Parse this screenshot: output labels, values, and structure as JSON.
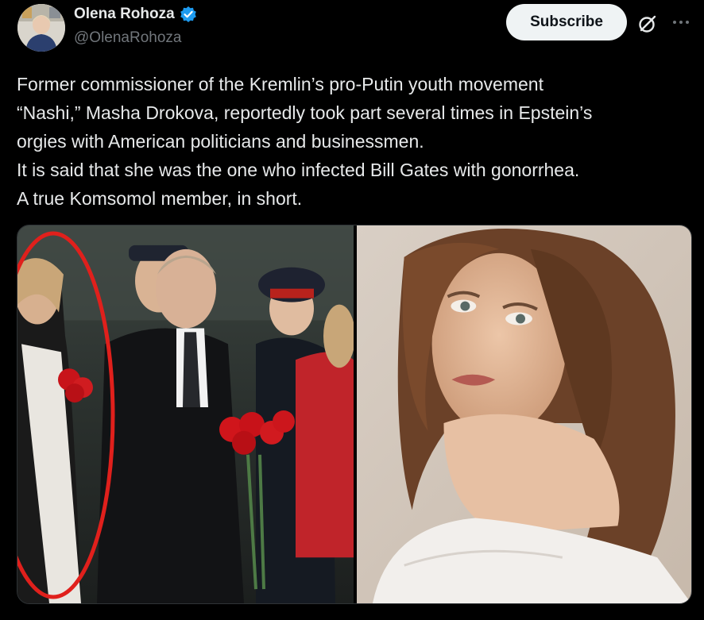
{
  "author": {
    "display_name": "Olena Rohoza",
    "handle": "@OlenaRohoza",
    "avatar_icon": "profile-avatar",
    "verified_icon": "verified-badge-icon",
    "verified_color": "#1d9bf0"
  },
  "actions": {
    "subscribe_label": "Subscribe",
    "grok_icon": "grok-icon",
    "more_icon": "more-options-icon"
  },
  "tweet": {
    "lines": [
      "Former commissioner of the Kremlin’s pro-Putin youth movement",
      "“Nashi,” Masha Drokova, reportedly took part several times in Epstein’s",
      "orgies with American politicians and businessmen.",
      "It is said that she was the one who infected Bill Gates with gonorrhea.",
      "A true Komsomol member, in short."
    ]
  },
  "media": {
    "count": 2,
    "accent_circle_color": "#e0201c"
  },
  "colors": {
    "background": "#000000",
    "text": "#e7e9ea",
    "secondary": "#71767b",
    "button_bg": "#eff3f4"
  }
}
